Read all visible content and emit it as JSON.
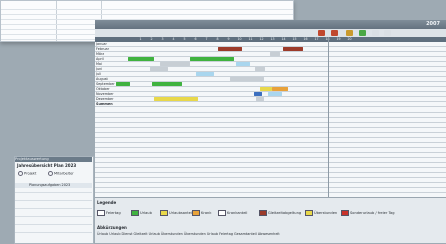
{
  "window": {
    "title": "2007"
  },
  "grid": {
    "day_numbers": [
      "1",
      "2",
      "3",
      "4",
      "5",
      "6",
      "7",
      "8",
      "9",
      "10",
      "11",
      "12",
      "13",
      "14",
      "15",
      "16",
      "17",
      "18",
      "19",
      "20"
    ],
    "rows": [
      {
        "name": "Januar",
        "vals": [
          "",
          "",
          "",
          ""
        ]
      },
      {
        "name": "Februar",
        "vals": [
          "",
          "",
          "",
          ""
        ]
      },
      {
        "name": "März",
        "vals": [
          "",
          "",
          "",
          ""
        ]
      },
      {
        "name": "April",
        "vals": [
          "",
          "",
          "",
          ""
        ]
      },
      {
        "name": "Mai",
        "vals": [
          "",
          "",
          "",
          ""
        ]
      },
      {
        "name": "Juni",
        "vals": [
          "",
          "",
          "",
          ""
        ]
      },
      {
        "name": "Juli",
        "vals": [
          "",
          "",
          "",
          ""
        ]
      },
      {
        "name": "August",
        "vals": [
          "",
          "",
          "",
          ""
        ]
      },
      {
        "name": "September",
        "vals": [
          "",
          "",
          "",
          ""
        ]
      },
      {
        "name": "Oktober",
        "vals": [
          "",
          "",
          "",
          ""
        ]
      },
      {
        "name": "November",
        "vals": [
          "",
          "",
          "",
          ""
        ]
      },
      {
        "name": "Dezember",
        "vals": [
          "",
          "",
          "",
          ""
        ]
      },
      {
        "name": "Summen",
        "vals": [
          "",
          "",
          "",
          ""
        ]
      }
    ],
    "bar_colors": {
      "red": "#9c3b2a",
      "green": "#3fb23f",
      "yellow": "#e8d84a",
      "lightblue": "#a9d6ee",
      "orange": "#e8a23a",
      "blue": "#3b6fbf",
      "gray": "#c7ced4"
    }
  },
  "legend": {
    "title": "Legende",
    "items": [
      {
        "label": "Feiertag",
        "color": "#ffffff"
      },
      {
        "label": "Urlaub",
        "color": "#3fb23f"
      },
      {
        "label": "Urlaubsanteil",
        "color": "#e8d84a"
      },
      {
        "label": "Krank",
        "color": "#e8a23a"
      },
      {
        "label": "Krankanteil",
        "color": "#ffffff"
      },
      {
        "label": "Gleitzeitabgeltung",
        "color": "#9c3b2a"
      },
      {
        "label": "Überstunden",
        "color": "#e8d84a"
      },
      {
        "label": "Sonderurlaub / freier Tag",
        "color": "#c9322a"
      }
    ]
  },
  "abbreviations": {
    "title": "Abkürzungen",
    "text": "Ürlaub Urlaub Dienst Gleitzeit Urlaub Überstunden Überstunden Urlaub Feiertag Gesamtanteil Abwesenheit"
  },
  "side_panel": {
    "title": "Projektauswertung",
    "subtitle": "Jahresübersicht Plan 2023",
    "options": [
      "Projekt",
      "Mitarbeiter"
    ],
    "list_item": "Planungsaufgaben 2023"
  }
}
